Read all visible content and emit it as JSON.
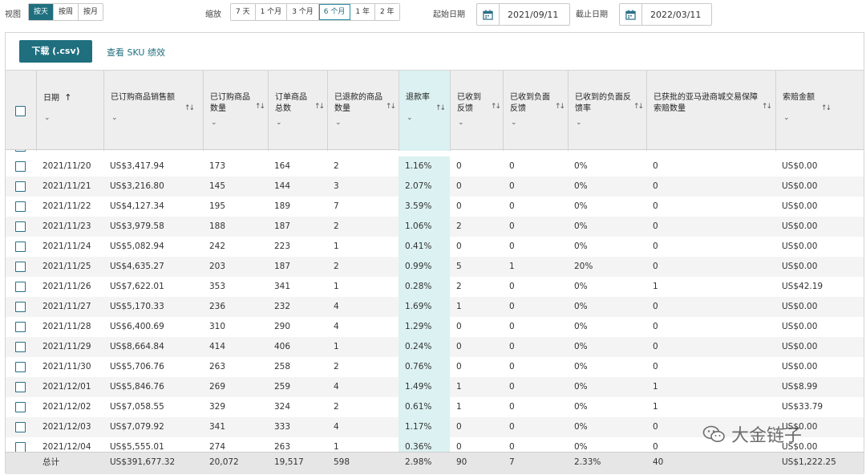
{
  "toolbar": {
    "view_label": "视图",
    "view_options": [
      "按天",
      "按周",
      "按月"
    ],
    "zoom_label": "缩放",
    "zoom_options": [
      "7 天",
      "1 个月",
      "3 个月",
      "6 个月",
      "1 年",
      "2 年"
    ],
    "start_label": "起始日期",
    "start_date": "2021/09/11",
    "end_label": "截止日期",
    "end_date": "2022/03/11"
  },
  "actions": {
    "download_label": "下载 (.csv)",
    "sku_link": "查看 SKU 绩效"
  },
  "table": {
    "headers": {
      "date": "日期",
      "sales": "已订购商品销售额",
      "units": "已订购商品数量",
      "orders": "订单商品总数",
      "refund_units": "已退款的商品数量",
      "refund_rate": "退款率",
      "feedback": "已收到反馈",
      "neg_feedback": "已收到负面反馈",
      "neg_rate": "已收到的负面反馈率",
      "claims": "已获批的亚马逊商城交易保障索赔数量",
      "claim_amount": "索赔金额"
    },
    "rows": [
      [
        "2021/11/20",
        "US$3,417.94",
        "173",
        "164",
        "2",
        "1.16%",
        "0",
        "0",
        "0%",
        "0",
        "US$0.00"
      ],
      [
        "2021/11/21",
        "US$3,216.80",
        "145",
        "144",
        "3",
        "2.07%",
        "0",
        "0",
        "0%",
        "0",
        "US$0.00"
      ],
      [
        "2021/11/22",
        "US$4,127.34",
        "195",
        "189",
        "7",
        "3.59%",
        "0",
        "0",
        "0%",
        "0",
        "US$0.00"
      ],
      [
        "2021/11/23",
        "US$3,979.58",
        "188",
        "187",
        "2",
        "1.06%",
        "2",
        "0",
        "0%",
        "0",
        "US$0.00"
      ],
      [
        "2021/11/24",
        "US$5,082.94",
        "242",
        "223",
        "1",
        "0.41%",
        "0",
        "0",
        "0%",
        "0",
        "US$0.00"
      ],
      [
        "2021/11/25",
        "US$4,635.27",
        "203",
        "187",
        "2",
        "0.99%",
        "5",
        "1",
        "20%",
        "0",
        "US$0.00"
      ],
      [
        "2021/11/26",
        "US$7,622.01",
        "353",
        "341",
        "1",
        "0.28%",
        "2",
        "0",
        "0%",
        "1",
        "US$42.19"
      ],
      [
        "2021/11/27",
        "US$5,170.33",
        "236",
        "232",
        "4",
        "1.69%",
        "1",
        "0",
        "0%",
        "0",
        "US$0.00"
      ],
      [
        "2021/11/28",
        "US$6,400.69",
        "310",
        "290",
        "4",
        "1.29%",
        "0",
        "0",
        "0%",
        "0",
        "US$0.00"
      ],
      [
        "2021/11/29",
        "US$8,664.84",
        "414",
        "406",
        "1",
        "0.24%",
        "0",
        "0",
        "0%",
        "0",
        "US$0.00"
      ],
      [
        "2021/11/30",
        "US$5,706.76",
        "263",
        "258",
        "2",
        "0.76%",
        "0",
        "0",
        "0%",
        "0",
        "US$0.00"
      ],
      [
        "2021/12/01",
        "US$5,846.76",
        "269",
        "259",
        "4",
        "1.49%",
        "1",
        "0",
        "0%",
        "1",
        "US$8.99"
      ],
      [
        "2021/12/02",
        "US$7,058.55",
        "329",
        "324",
        "2",
        "0.61%",
        "1",
        "0",
        "0%",
        "1",
        "US$33.79"
      ],
      [
        "2021/12/03",
        "US$7,079.92",
        "341",
        "333",
        "4",
        "1.17%",
        "0",
        "0",
        "0%",
        "0",
        "US$0.00"
      ],
      [
        "2021/12/04",
        "US$5,555.01",
        "274",
        "263",
        "1",
        "0.36%",
        "0",
        "0",
        "0%",
        "0",
        "US$0.00"
      ]
    ],
    "totals": [
      "总计",
      "US$391,677.32",
      "20,072",
      "19,517",
      "598",
      "2.98%",
      "90",
      "7",
      "2.33%",
      "40",
      "US$1,222.25"
    ]
  },
  "watermark": "大金链子",
  "colors": {
    "accent": "#1f6f7f",
    "highlight_column": "#dcf1f1"
  }
}
